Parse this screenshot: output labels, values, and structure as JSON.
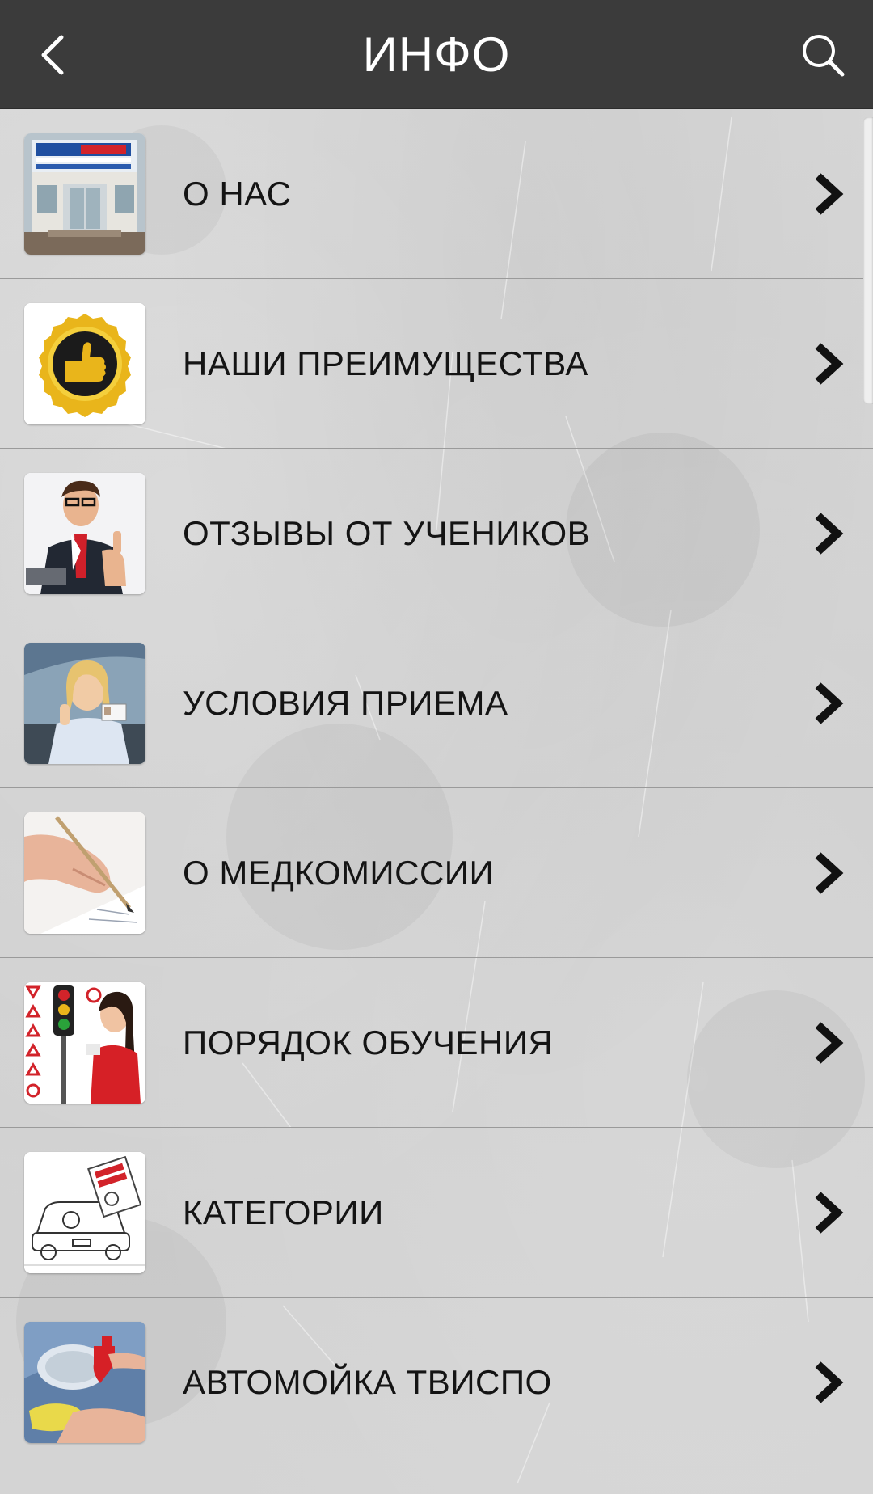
{
  "header": {
    "title": "ИНФО",
    "back_icon": "chevron-left-icon",
    "search_icon": "search-icon"
  },
  "colors": {
    "header_bg": "#3b3b3b",
    "header_text": "#ffffff",
    "list_bg": "#d2d2d2",
    "label_text": "#141414",
    "divider": "#9a9a9a"
  },
  "menu": {
    "items": [
      {
        "label": "О НАС",
        "thumb": "school-building-photo"
      },
      {
        "label": "НАШИ ПРЕИМУЩЕСТВА",
        "thumb": "thumbs-up-seal-image"
      },
      {
        "label": "ОТЗЫВЫ ОТ УЧЕНИКОВ",
        "thumb": "businessman-thumbs-up-photo"
      },
      {
        "label": "УСЛОВИЯ ПРИЕМА",
        "thumb": "woman-driver-license-photo"
      },
      {
        "label": "О МЕДКОМИССИИ",
        "thumb": "hand-signing-document-photo"
      },
      {
        "label": "ПОРЯДОК ОБУЧЕНИЯ",
        "thumb": "traffic-light-woman-photo"
      },
      {
        "label": "КАТЕГОРИИ",
        "thumb": "car-driving-license-drawing"
      },
      {
        "label": "АВТОМОЙКА ТВИСПО",
        "thumb": "car-wash-photo"
      }
    ],
    "chevron_icon": "chevron-right-icon"
  }
}
